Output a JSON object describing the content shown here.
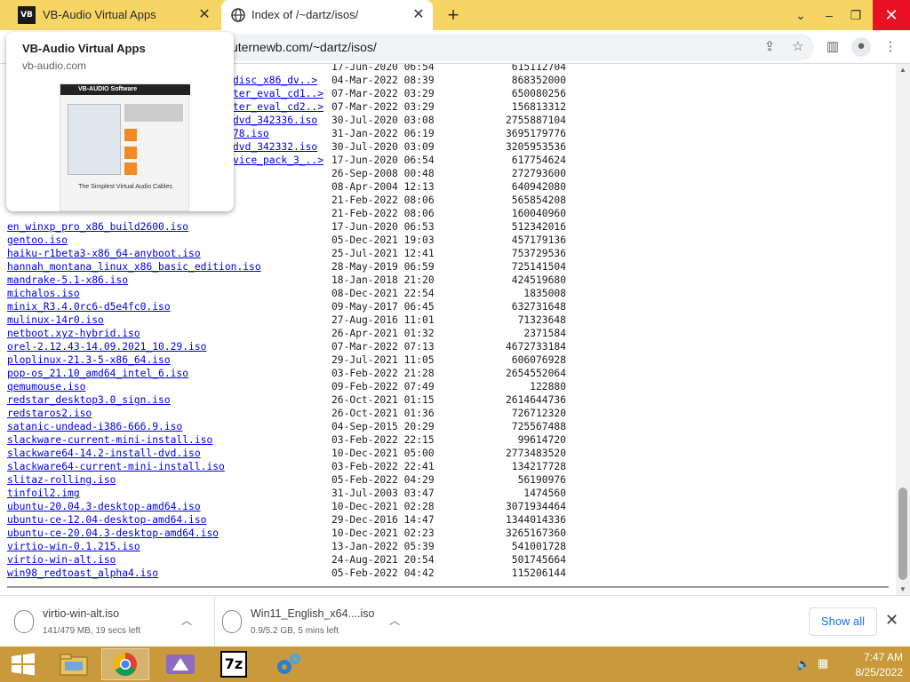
{
  "tabs": [
    {
      "title": "VB-Audio Virtual Apps",
      "icon": "vb-audio-icon"
    },
    {
      "title": "Index of /~dartz/isos/",
      "icon": "globe-icon"
    }
  ],
  "window": {
    "chevron": "⌄",
    "minimize": "–",
    "maximize": "❐",
    "close": "✕"
  },
  "toolbar": {
    "url": "uternewb.com/~dartz/isos/"
  },
  "hovercard": {
    "title": "VB-Audio Virtual Apps",
    "domain": "vb-audio.com",
    "thumb_header": "VB-AUDIO Software",
    "thumb_tagline": "The Simplest Virtual Audio Cables"
  },
  "files": [
    {
      "name": "",
      "date": "17-Jun-2020 06:54",
      "size": "615112704"
    },
    {
      "name": "disc_x86_dv..>",
      "date": "04-Mar-2022 08:39",
      "size": "868352000"
    },
    {
      "name": "ter_eval_cd1..>",
      "date": "07-Mar-2022 03:29",
      "size": "650080256"
    },
    {
      "name": "ter_eval_cd2..>",
      "date": "07-Mar-2022 03:29",
      "size": "156813312"
    },
    {
      "name": "dvd_342336.iso",
      "date": "30-Jul-2020 03:08",
      "size": "2755887104"
    },
    {
      "name": "78.iso",
      "date": "31-Jan-2022 06:19",
      "size": "3695179776"
    },
    {
      "name": "dvd_342332.iso",
      "date": "30-Jul-2020 03:09",
      "size": "3205953536"
    },
    {
      "name": "vice_pack_3_..>",
      "date": "17-Jun-2020 06:54",
      "size": "617754624"
    },
    {
      "name": "",
      "date": "26-Sep-2008 00:48",
      "size": "272793600"
    },
    {
      "name": "",
      "date": "08-Apr-2004 12:13",
      "size": "640942080"
    },
    {
      "name": "",
      "date": "21-Feb-2022 08:06",
      "size": "565854208"
    },
    {
      "name": "",
      "date": "21-Feb-2022 08:06",
      "size": "160040960"
    },
    {
      "name": "en_winxp_pro_x86_build2600.iso",
      "date": "17-Jun-2020 06:53",
      "size": "512342016"
    },
    {
      "name": "gentoo.iso",
      "date": "05-Dec-2021 19:03",
      "size": "457179136"
    },
    {
      "name": "haiku-r1beta3-x86_64-anyboot.iso",
      "date": "25-Jul-2021 12:41",
      "size": "753729536"
    },
    {
      "name": "hannah_montana_linux_x86_basic_edition.iso",
      "date": "28-May-2019 06:59",
      "size": "725141504"
    },
    {
      "name": "mandrake-5.1-x86.iso",
      "date": "18-Jan-2018 21:20",
      "size": "424519680"
    },
    {
      "name": "michalos.iso",
      "date": "08-Dec-2021 22:54",
      "size": "1835008"
    },
    {
      "name": "minix_R3.4.0rc6-d5e4fc0.iso",
      "date": "09-May-2017 06:45",
      "size": "632731648"
    },
    {
      "name": "mulinux-14r0.iso",
      "date": "27-Aug-2016 11:01",
      "size": "71323648"
    },
    {
      "name": "netboot.xyz-hybrid.iso",
      "date": "26-Apr-2021 01:32",
      "size": "2371584"
    },
    {
      "name": "orel-2.12.43-14.09.2021_10.29.iso",
      "date": "07-Mar-2022 07:13",
      "size": "4672733184"
    },
    {
      "name": "ploplinux-21.3-5-x86_64.iso",
      "date": "29-Jul-2021 11:05",
      "size": "606076928"
    },
    {
      "name": "pop-os_21.10_amd64_intel_6.iso",
      "date": "03-Feb-2022 21:28",
      "size": "2654552064"
    },
    {
      "name": "qemumouse.iso",
      "date": "09-Feb-2022 07:49",
      "size": "122880"
    },
    {
      "name": "redstar_desktop3.0_sign.iso",
      "date": "26-Oct-2021 01:15",
      "size": "2614644736"
    },
    {
      "name": "redstaros2.iso",
      "date": "26-Oct-2021 01:36",
      "size": "726712320"
    },
    {
      "name": "satanic-undead-i386-666.9.iso",
      "date": "04-Sep-2015 20:29",
      "size": "725567488"
    },
    {
      "name": "slackware-current-mini-install.iso",
      "date": "03-Feb-2022 22:15",
      "size": "99614720"
    },
    {
      "name": "slackware64-14.2-install-dvd.iso",
      "date": "10-Dec-2021 05:00",
      "size": "2773483520"
    },
    {
      "name": "slackware64-current-mini-install.iso",
      "date": "03-Feb-2022 22:41",
      "size": "134217728"
    },
    {
      "name": "slitaz-rolling.iso",
      "date": "05-Feb-2022 04:29",
      "size": "56190976"
    },
    {
      "name": "tinfoil2.img",
      "date": "31-Jul-2003 03:47",
      "size": "1474560"
    },
    {
      "name": "ubuntu-20.04.3-desktop-amd64.iso",
      "date": "10-Dec-2021 02:28",
      "size": "3071934464"
    },
    {
      "name": "ubuntu-ce-12.04-desktop-amd64.iso",
      "date": "29-Dec-2016 14:47",
      "size": "1344014336"
    },
    {
      "name": "ubuntu-ce-20.04.3-desktop-amd64.iso",
      "date": "10-Dec-2021 02:23",
      "size": "3265167360"
    },
    {
      "name": "virtio-win-0.1.215.iso",
      "date": "13-Jan-2022 05:39",
      "size": "541001728"
    },
    {
      "name": "virtio-win-alt.iso",
      "date": "24-Aug-2021 20:54",
      "size": "501745664"
    },
    {
      "name": "win98_redtoast_alpha4.iso",
      "date": "05-Feb-2022 04:42",
      "size": "115206144"
    }
  ],
  "downloads": [
    {
      "name": "virtio-win-alt.iso",
      "status": "141/479 MB, 19 secs left"
    },
    {
      "name": "Win11_English_x64....iso",
      "status": "0.9/5.2 GB, 5 mins left"
    }
  ],
  "shelf": {
    "show_all": "Show all",
    "close": "✕"
  },
  "taskbar": {
    "time": "7:47 AM",
    "date": "8/25/2022",
    "seven_zip": "7z"
  },
  "colors": {
    "tab_strip": "#f6d565",
    "link": "#0000ee",
    "taskbar": "#c89a3c",
    "close_button": "#e81123"
  }
}
